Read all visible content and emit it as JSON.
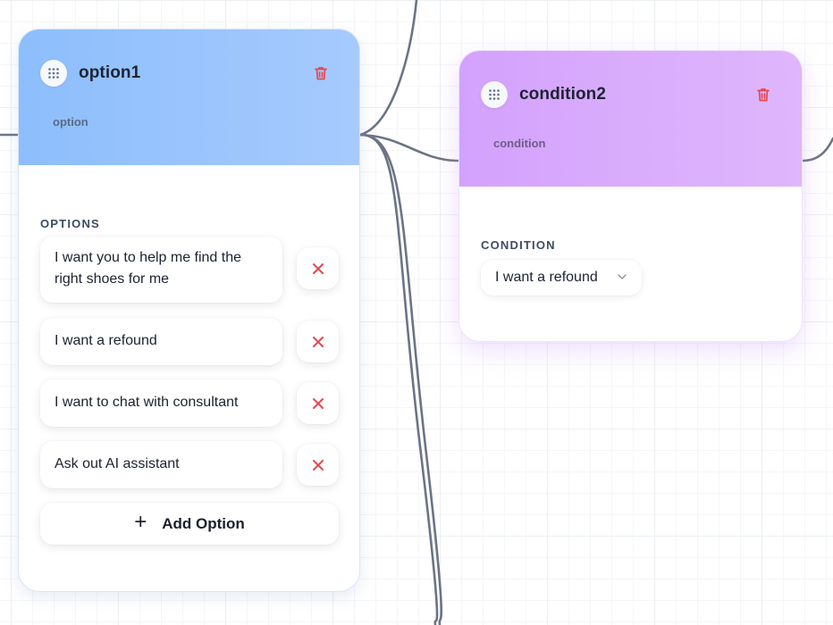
{
  "canvas": {
    "edge_color": "#6b7486"
  },
  "option_node": {
    "title": "option1",
    "type_label": "option",
    "section_label": "OPTIONS",
    "options": [
      {
        "line1": "I want you to help me find the",
        "line2": "right shoes for me"
      },
      {
        "line1": "I want a refound"
      },
      {
        "line1": "I want to chat with consultant"
      },
      {
        "line1": "Ask out AI assistant"
      }
    ],
    "add_option_label": "Add Option",
    "add_icon": "+",
    "header_color": "#8dbefc",
    "icons": {
      "handle": "drag-grid-icon",
      "delete": "trash-icon",
      "remove": "close-x-icon"
    }
  },
  "condition_node": {
    "title": "condition2",
    "type_label": "condition",
    "section_label": "CONDITION",
    "selected_value": "I want a refound",
    "header_color": "#d3a2fd",
    "icons": {
      "handle": "drag-grid-icon",
      "delete": "trash-icon",
      "dropdown": "chevron-down-icon"
    }
  },
  "colors": {
    "delete_red": "#e5484d",
    "text_dark": "#1c2230"
  }
}
